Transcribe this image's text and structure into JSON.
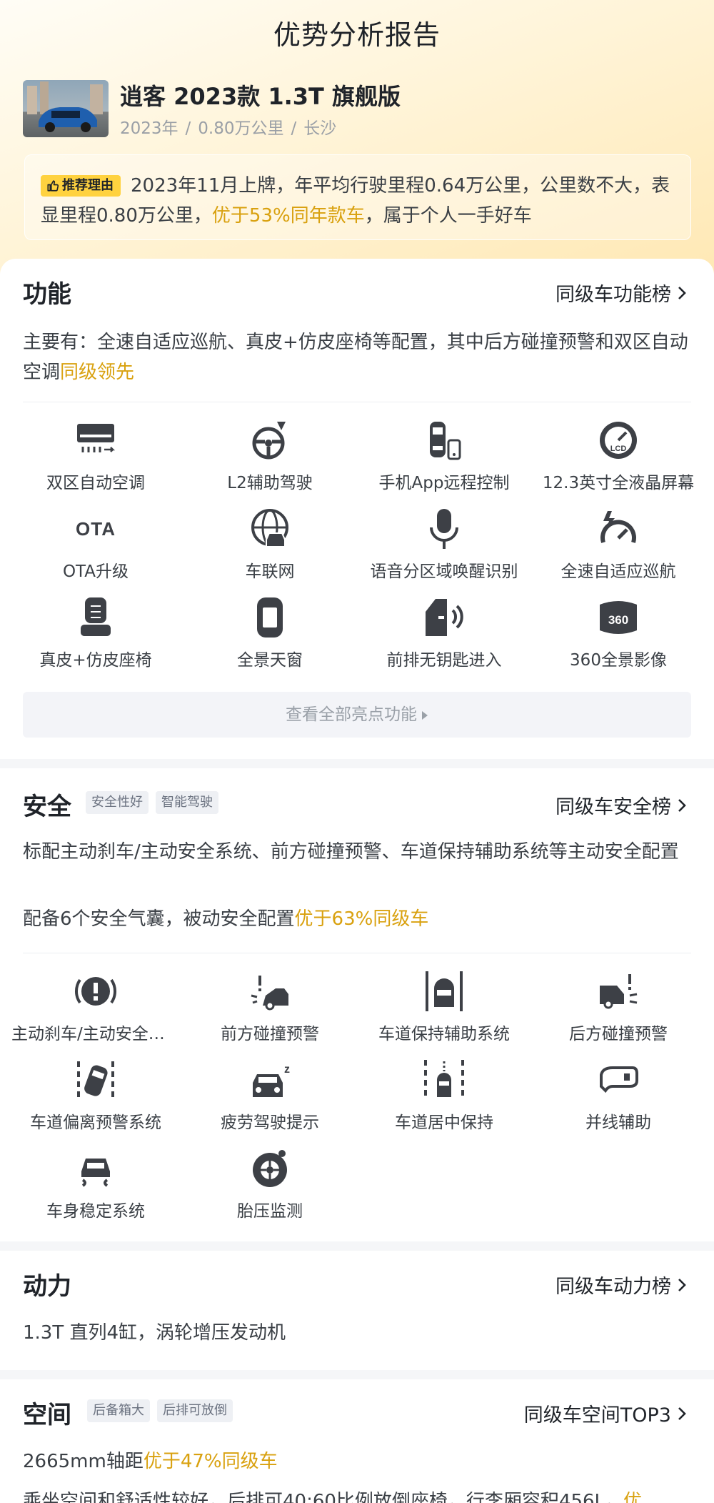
{
  "header": {
    "title": "优势分析报告"
  },
  "car": {
    "name": "逍客 2023款 1.3T 旗舰版",
    "year": "2023年",
    "mileage": "0.80万公里",
    "city": "长沙",
    "sep": "/"
  },
  "reason": {
    "tag": "推荐理由",
    "text_before": "2023年11月上牌，年平均行驶里程0.64万公里，公里数不大，表显里程0.80万公里，",
    "highlight": "优于53%同年款车",
    "text_after": "，属于个人一手好车"
  },
  "function": {
    "title": "功能",
    "link": "同级车功能榜",
    "desc_before": "主要有：全速自适应巡航、真皮+仿皮座椅等配置，其中后方碰撞预警和双区自动空调",
    "desc_highlight": "同级领先",
    "items": [
      {
        "label": "双区自动空调",
        "icon": "ac-icon"
      },
      {
        "label": "L2辅助驾驶",
        "icon": "assisted-driving-icon"
      },
      {
        "label": "手机App远程控制",
        "icon": "phone-remote-icon"
      },
      {
        "label": "12.3英寸全液晶屏幕",
        "icon": "lcd-gauge-icon"
      },
      {
        "label": "OTA升级",
        "icon": "ota-icon",
        "icon_text": "OTA"
      },
      {
        "label": "车联网",
        "icon": "connected-car-icon"
      },
      {
        "label": "语音分区域唤醒识别",
        "icon": "microphone-icon"
      },
      {
        "label": "全速自适应巡航",
        "icon": "cruise-icon"
      },
      {
        "label": "真皮+仿皮座椅",
        "icon": "seat-icon"
      },
      {
        "label": "全景天窗",
        "icon": "sunroof-icon"
      },
      {
        "label": "前排无钥匙进入",
        "icon": "keyless-door-icon"
      },
      {
        "label": "360全景影像",
        "icon": "camera-360-icon",
        "icon_text": "360"
      }
    ],
    "view_all": "查看全部亮点功能"
  },
  "safety": {
    "title": "安全",
    "tags": [
      "安全性好",
      "智能驾驶"
    ],
    "link": "同级车安全榜",
    "desc1": "标配主动刹车/主动安全系统、前方碰撞预警、车道保持辅助系统等主动安全配置",
    "desc2_before": "配备6个安全气囊，被动安全配置",
    "desc2_highlight": "优于63%同级车",
    "items": [
      {
        "label": "主动刹车/主动安全系统",
        "icon": "brake-warning-icon"
      },
      {
        "label": "前方碰撞预警",
        "icon": "front-collision-icon"
      },
      {
        "label": "车道保持辅助系统",
        "icon": "lane-keep-icon"
      },
      {
        "label": "后方碰撞预警",
        "icon": "rear-collision-icon"
      },
      {
        "label": "车道偏离预警系统",
        "icon": "lane-departure-icon"
      },
      {
        "label": "疲劳驾驶提示",
        "icon": "fatigue-icon"
      },
      {
        "label": "车道居中保持",
        "icon": "lane-center-icon"
      },
      {
        "label": "并线辅助",
        "icon": "mirror-blind-spot-icon"
      },
      {
        "label": "车身稳定系统",
        "icon": "stability-icon"
      },
      {
        "label": "胎压监测",
        "icon": "tire-pressure-icon"
      }
    ]
  },
  "power": {
    "title": "动力",
    "link": "同级车动力榜",
    "desc": "1.3T 直列4缸，涡轮增压发动机"
  },
  "space": {
    "title": "空间",
    "tags": [
      "后备箱大",
      "后排可放倒"
    ],
    "link": "同级车空间TOP3",
    "desc1_before": "2665mm轴距",
    "desc1_highlight": "优于47%同级车",
    "desc2_before": "乘坐空间和舒适性较好，后排可40:60比例放倒座椅，行李厢容积456L，",
    "desc2_highlight": "优"
  },
  "colors": {
    "accent": "#d9a10f",
    "tag_yellow": "#ffd23f",
    "icon": "#3d4046"
  }
}
